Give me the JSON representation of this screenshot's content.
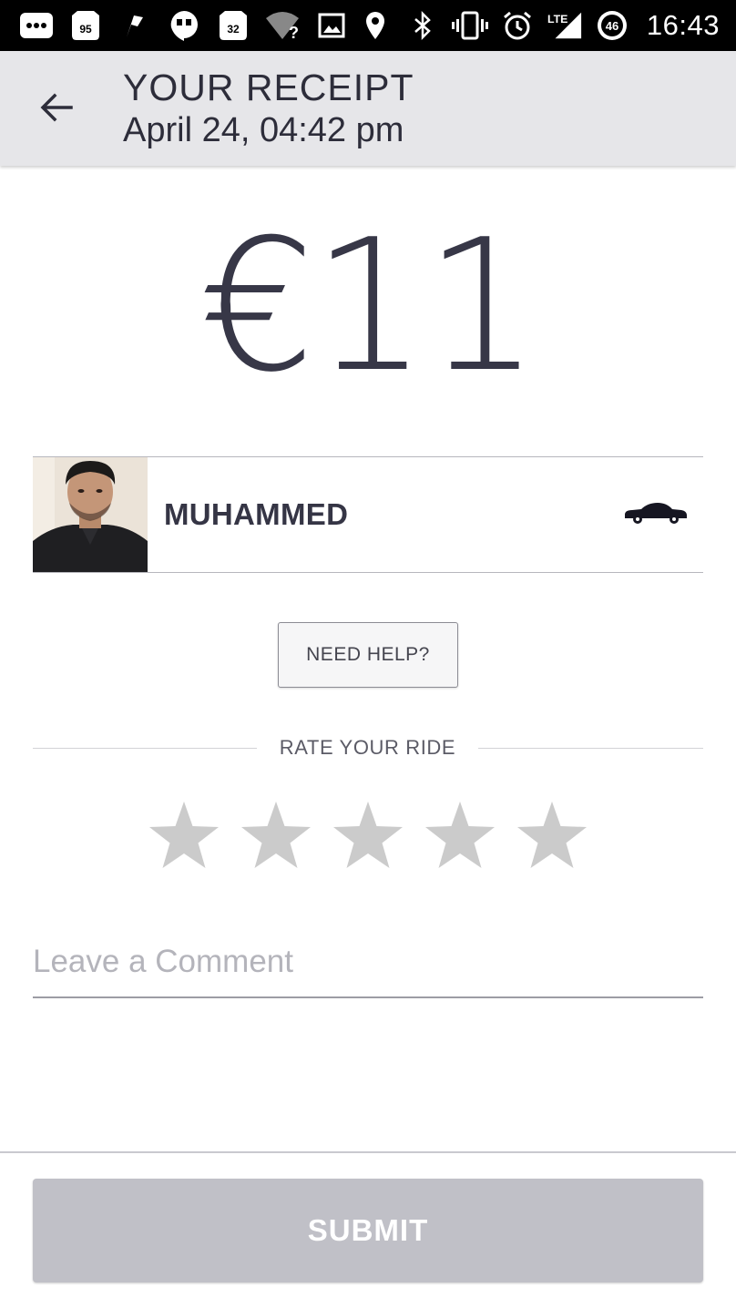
{
  "status_bar": {
    "time": "16:43",
    "notification_icons": [
      "more-horiz-icon",
      "speed-badge-icon",
      "flag-icon",
      "hangouts-icon",
      "speed-badge-icon",
      "wifi-question-icon",
      "image-icon"
    ],
    "badge_values": [
      "95",
      "32"
    ],
    "system_icons": [
      "location-icon",
      "bluetooth-icon",
      "vibrate-icon",
      "alarm-icon",
      "lte-signal-icon",
      "battery-icon"
    ],
    "network_label": "LTE",
    "battery_level": "46"
  },
  "header": {
    "title": "YOUR RECEIPT",
    "subtitle": "April 24, 04:42 pm",
    "back_icon": "arrow-back-icon"
  },
  "receipt": {
    "fare": "€11"
  },
  "driver": {
    "name": "MUHAMMED",
    "vehicle_icon": "sedan-car-icon"
  },
  "help": {
    "label": "NEED HELP?"
  },
  "rating": {
    "label": "RATE YOUR RIDE",
    "max_stars": 5,
    "selected": 0,
    "star_color": "#cbcbcb"
  },
  "comment": {
    "placeholder": "Leave a Comment",
    "value": ""
  },
  "submit": {
    "label": "SUBMIT",
    "enabled": false,
    "color": "#c0c0c7"
  },
  "colors": {
    "status_bar": "#000000",
    "app_bar": "#e6e6e9",
    "primary_text": "#2d2d3a"
  }
}
